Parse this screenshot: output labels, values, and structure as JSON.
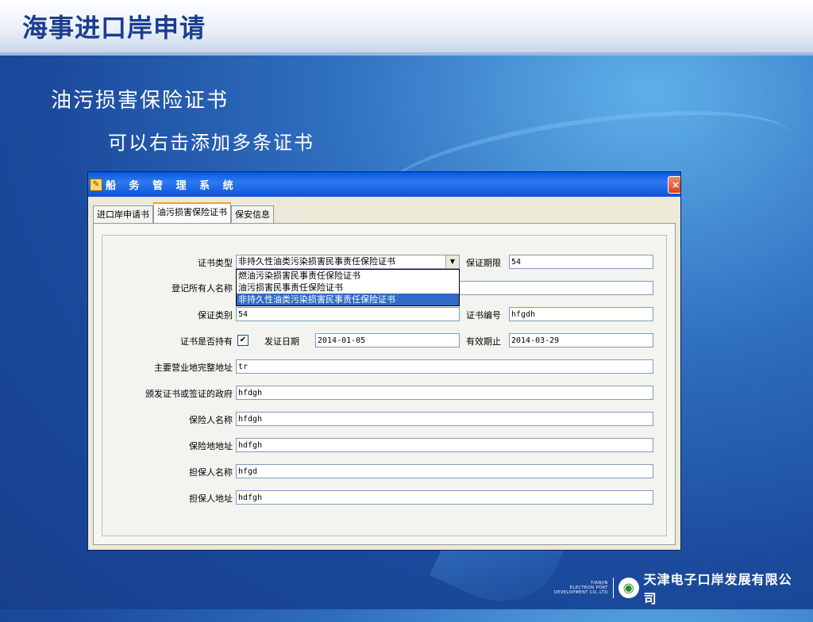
{
  "slide": {
    "title": "海事进口岸申请",
    "heading": "油污损害保险证书",
    "subheading": "可以右击添加多条证书"
  },
  "window": {
    "title": "船 务 管 理 系 统",
    "close_icon": "×"
  },
  "tabs": [
    {
      "label": "进口岸申请书",
      "active": false
    },
    {
      "label": "油污损害保险证书",
      "active": true
    },
    {
      "label": "保安信息",
      "active": false
    }
  ],
  "form": {
    "cert_type_label": "证书类型",
    "cert_type_value": "非持久性油类污染损害民事责任保险证书",
    "cert_type_options": [
      "燃油污染损害民事责任保险证书",
      "油污损害民事责任保险证书",
      "非持久性油类污染损害民事责任保险证书"
    ],
    "guarantee_period_label": "保证期限",
    "guarantee_period_value": "54",
    "owner_name_label": "登记所有人名称",
    "owner_name_value": "",
    "guarantee_type_label": "保证类别",
    "guarantee_type_value": "54",
    "cert_no_label": "证书编号",
    "cert_no_value": "hfgdh",
    "holds_cert_label": "证书是否持有",
    "holds_cert_checked": "✔",
    "issue_date_label": "发证日期",
    "issue_date_value": "2014-01-05",
    "expiry_label": "有效期止",
    "expiry_value": "2014-03-29",
    "business_address_label": "主要营业地完整地址",
    "business_address_value": "tr",
    "issuing_gov_label": "颁发证书或签证的政府",
    "issuing_gov_value": "hfdgh",
    "insurer_name_label": "保险人名称",
    "insurer_name_value": "hfdgh",
    "insurer_address_label": "保险地地址",
    "insurer_address_value": "hdfgh",
    "guarantor_name_label": "担保人名称",
    "guarantor_name_value": "hfgd",
    "guarantor_address_label": "担保人地址",
    "guarantor_address_value": "hdfgh"
  },
  "footer": {
    "company_en_1": "TIANJIN",
    "company_en_2": "ELECTRON PORT",
    "company_en_3": "DEVELOPMENT CO.,LTD",
    "company_cn": "天津电子口岸发展有限公司"
  }
}
